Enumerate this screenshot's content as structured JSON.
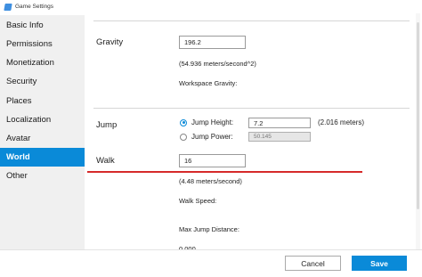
{
  "window": {
    "title": "Game Settings"
  },
  "sidebar": {
    "items": [
      {
        "label": "Basic Info"
      },
      {
        "label": "Permissions"
      },
      {
        "label": "Monetization"
      },
      {
        "label": "Security"
      },
      {
        "label": "Places"
      },
      {
        "label": "Localization"
      },
      {
        "label": "Avatar"
      },
      {
        "label": "World",
        "active": true
      },
      {
        "label": "Other"
      }
    ]
  },
  "world": {
    "gravity": {
      "label": "Gravity",
      "value": "196.2",
      "conversion": "(54.936 meters/second^2)",
      "workspace_label": "Workspace Gravity:"
    },
    "jump": {
      "label": "Jump",
      "height_option": "Jump Height:",
      "height_value": "7.2",
      "height_meters": "(2.016 meters)",
      "power_option": "Jump Power:",
      "power_value": "50.145",
      "selected": "Jump Height"
    },
    "walk": {
      "label": "Walk",
      "value": "16",
      "conversion": "(4.48 meters/second)",
      "walk_speed_label": "Walk Speed:",
      "max_jump_label": "Max Jump Distance:",
      "max_jump_partial": "0.000"
    }
  },
  "footer": {
    "cancel_label": "Cancel",
    "save_label": "Save"
  },
  "colors": {
    "accent": "#0a8ad8",
    "annotation": "#d62a2a"
  }
}
